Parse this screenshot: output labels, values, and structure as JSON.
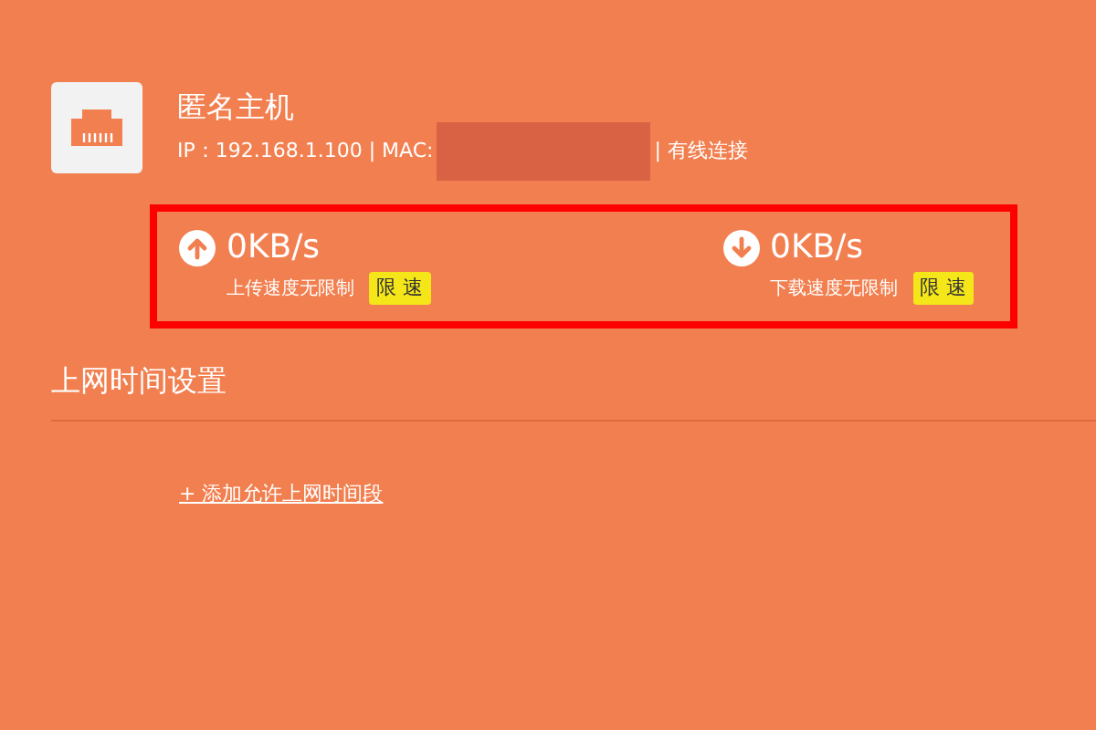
{
  "host": {
    "name": "匿名主机",
    "ip_label": "IP：192.168.1.100 | MAC:",
    "connection": "| 有线连接"
  },
  "speeds": [
    {
      "kind": "upload",
      "value": "0KB/s",
      "status": "上传速度无限制",
      "button": "限 速"
    },
    {
      "kind": "download",
      "value": "0KB/s",
      "status": "下载速度无限制",
      "button": "限 速"
    }
  ],
  "section": {
    "title": "上网时间设置",
    "link": "+ 添加允许上网时间段"
  }
}
